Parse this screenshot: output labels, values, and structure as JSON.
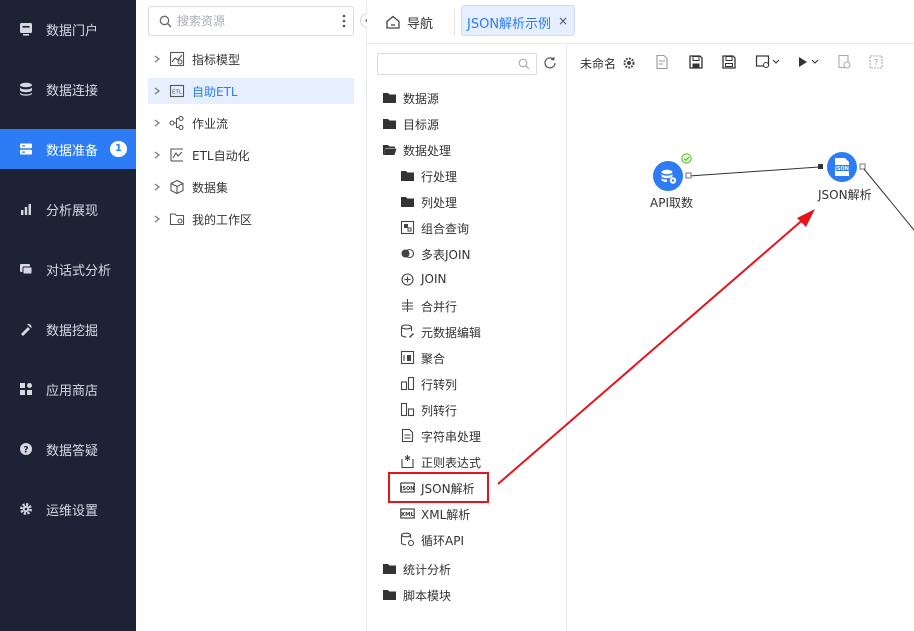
{
  "nav": {
    "items": [
      {
        "label": "数据门户",
        "icon": "portal-icon"
      },
      {
        "label": "数据连接",
        "icon": "database-icon"
      },
      {
        "label": "数据准备",
        "icon": "server-icon",
        "badge": "1",
        "active": true
      },
      {
        "label": "分析展现",
        "icon": "bar-chart-icon"
      },
      {
        "label": "对话式分析",
        "icon": "chat-icon"
      },
      {
        "label": "数据挖掘",
        "icon": "pickaxe-icon"
      },
      {
        "label": "应用商店",
        "icon": "grid-icon"
      },
      {
        "label": "数据答疑",
        "icon": "question-icon"
      },
      {
        "label": "运维设置",
        "icon": "gear-icon"
      }
    ]
  },
  "tree": {
    "search_placeholder": "搜索资源",
    "items": [
      {
        "label": "指标模型",
        "icon": "metric-model-icon"
      },
      {
        "label": "自助ETL",
        "icon": "etl-icon",
        "active": true
      },
      {
        "label": "作业流",
        "icon": "workflow-icon"
      },
      {
        "label": "ETL自动化",
        "icon": "etl-automation-icon"
      },
      {
        "label": "数据集",
        "icon": "dataset-cube-icon"
      },
      {
        "label": "我的工作区",
        "icon": "workspace-icon"
      }
    ]
  },
  "tabs": {
    "home_label": "导航",
    "active_label": "JSON解析示例",
    "close": "×"
  },
  "operators": {
    "search_value": "",
    "folders": [
      {
        "label": "数据源"
      },
      {
        "label": "目标源"
      },
      {
        "label": "数据处理"
      }
    ],
    "items": [
      {
        "label": "行处理",
        "icon": "folder-icon"
      },
      {
        "label": "列处理",
        "icon": "folder-icon"
      },
      {
        "label": "组合查询",
        "icon": "combined-query-icon"
      },
      {
        "label": "多表JOIN",
        "icon": "multi-join-icon"
      },
      {
        "label": "JOIN",
        "icon": "join-plus-icon"
      },
      {
        "label": "合并行",
        "icon": "merge-rows-icon"
      },
      {
        "label": "元数据编辑",
        "icon": "metadata-edit-icon"
      },
      {
        "label": "聚合",
        "icon": "aggregate-icon"
      },
      {
        "label": "行转列",
        "icon": "row-to-column-icon"
      },
      {
        "label": "列转行",
        "icon": "column-to-row-icon"
      },
      {
        "label": "字符串处理",
        "icon": "string-process-icon"
      },
      {
        "label": "正则表达式",
        "icon": "regex-icon"
      },
      {
        "label": "JSON解析",
        "icon": "json-parse-icon",
        "highlighted": true
      },
      {
        "label": "XML解析",
        "icon": "xml-parse-icon"
      },
      {
        "label": "循环API",
        "icon": "loop-api-icon"
      }
    ],
    "folders_after": [
      {
        "label": "统计分析"
      },
      {
        "label": "脚本模块"
      }
    ]
  },
  "canvas": {
    "title": "未命名",
    "toolbar": [
      "settings-icon",
      "properties-icon",
      "save-icon",
      "save-as-icon",
      "preview-dropdown-icon",
      "run-dropdown-icon",
      "lock-icon",
      "help-icon"
    ],
    "nodes": [
      {
        "label": "API取数",
        "icon": "api-database-icon",
        "status": "success"
      },
      {
        "label": "JSON解析",
        "icon": "json-parse-node-icon"
      }
    ]
  },
  "colors": {
    "nav_bg": "#1e2235",
    "accent": "#2d7cf6",
    "highlight_red": "#e5141c",
    "success": "#52c41a"
  }
}
